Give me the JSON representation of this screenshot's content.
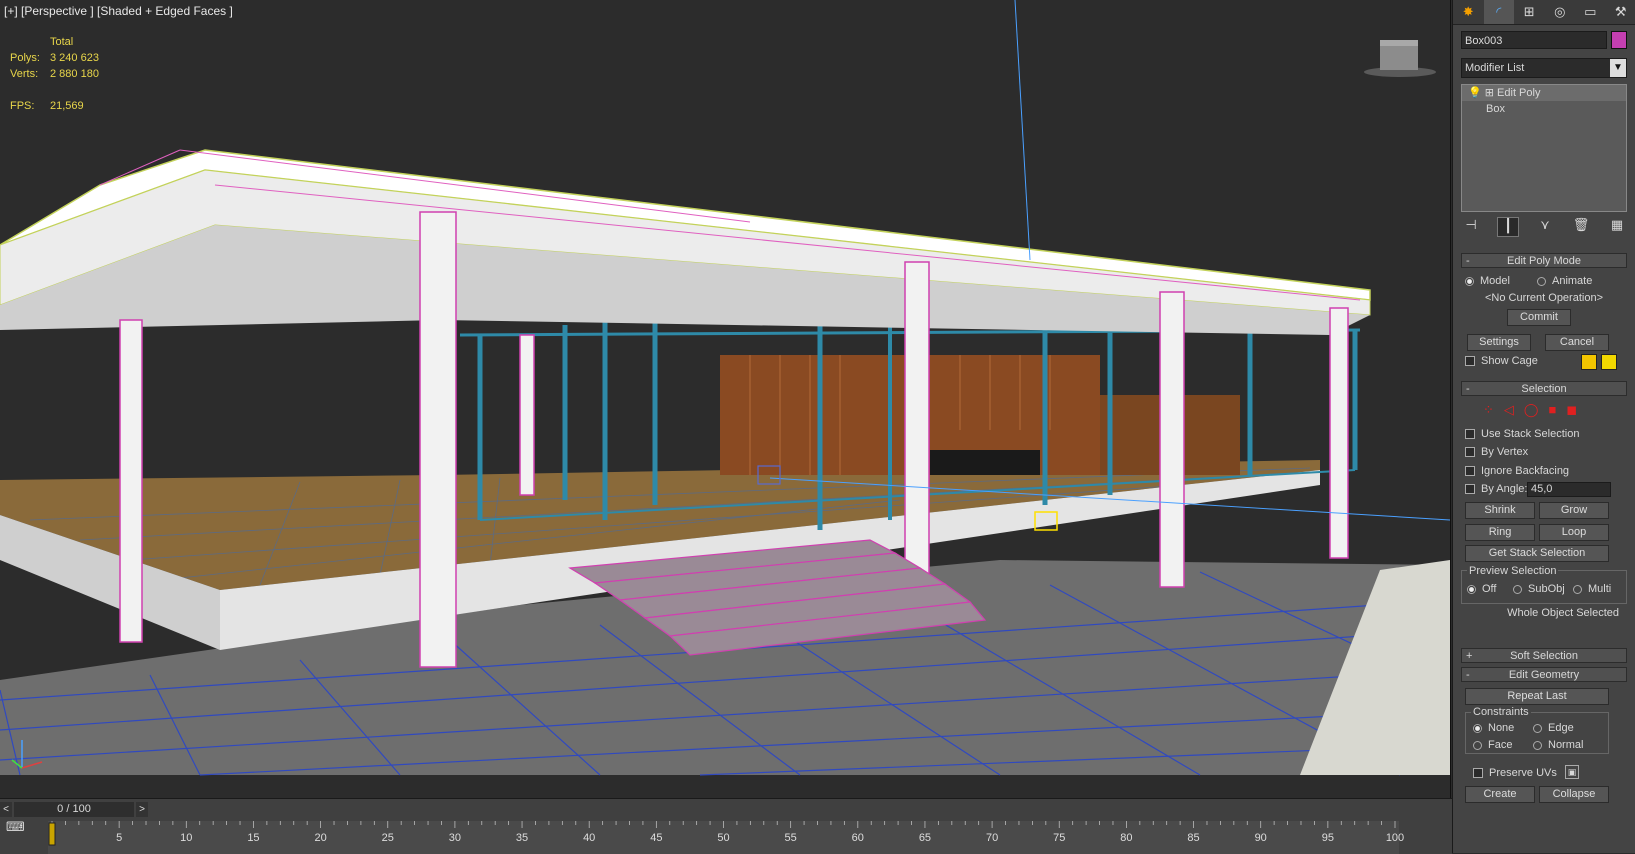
{
  "viewport": {
    "label": "[+] [Perspective ] [Shaded + Edged Faces ]",
    "stats": {
      "header": "Total",
      "polys_label": "Polys:",
      "polys_value": "3 240 623",
      "verts_label": "Verts:",
      "verts_value": "2 880 180",
      "fps_label": "FPS:",
      "fps_value": "21,569"
    },
    "viewcube_icon": "viewcube-icon",
    "axis_gizmo": "axis-tripod-icon"
  },
  "command_panel": {
    "tabs": [
      {
        "icon": "create-icon",
        "glyph": "✸"
      },
      {
        "icon": "modify-icon",
        "glyph": "◜"
      },
      {
        "icon": "hierarchy-icon",
        "glyph": "⊞"
      },
      {
        "icon": "motion-icon",
        "glyph": "◎"
      },
      {
        "icon": "display-icon",
        "glyph": "▭"
      },
      {
        "icon": "utilities-icon",
        "glyph": "⚒"
      }
    ],
    "object_name": "Box003",
    "object_color": "#c53fb1",
    "modifier_list_label": "Modifier List",
    "stack": [
      {
        "label": "Edit Poly",
        "selected": true
      },
      {
        "label": "Box",
        "selected": false
      }
    ],
    "stack_tools": [
      "pin-stack-icon",
      "show-end-result-icon",
      "make-unique-icon",
      "remove-modifier-icon",
      "configure-sets-icon"
    ],
    "edit_poly_mode": {
      "title": "Edit Poly Mode",
      "model_label": "Model",
      "animate_label": "Animate",
      "current_op": "<No Current Operation>",
      "commit_label": "Commit",
      "settings_label": "Settings",
      "cancel_label": "Cancel",
      "show_cage_label": "Show Cage",
      "cage_colors": [
        "#f2c500",
        "#f2d800"
      ]
    },
    "selection": {
      "title": "Selection",
      "use_stack_selection": "Use Stack Selection",
      "by_vertex": "By Vertex",
      "ignore_backfacing": "Ignore Backfacing",
      "by_angle": "By Angle:",
      "angle_value": "45,0",
      "shrink": "Shrink",
      "grow": "Grow",
      "ring": "Ring",
      "loop": "Loop",
      "get_stack_selection": "Get Stack Selection",
      "preview_selection_title": "Preview Selection",
      "preview_off": "Off",
      "preview_subobj": "SubObj",
      "preview_multi": "Multi",
      "status": "Whole Object Selected"
    },
    "soft_selection": {
      "title": "Soft Selection"
    },
    "edit_geometry": {
      "title": "Edit Geometry",
      "repeat_last": "Repeat Last",
      "constraints_title": "Constraints",
      "none": "None",
      "edge": "Edge",
      "face": "Face",
      "normal": "Normal",
      "preserve_uvs": "Preserve UVs",
      "create": "Create",
      "collapse": "Collapse"
    }
  },
  "timeline": {
    "frame_display": "0 / 100",
    "prev": "<",
    "next": ">",
    "ticks": [
      "0",
      "5",
      "10",
      "15",
      "20",
      "25",
      "30",
      "35",
      "40",
      "45",
      "50",
      "55",
      "60",
      "65",
      "70",
      "75",
      "80",
      "85",
      "90",
      "95",
      "100"
    ]
  }
}
